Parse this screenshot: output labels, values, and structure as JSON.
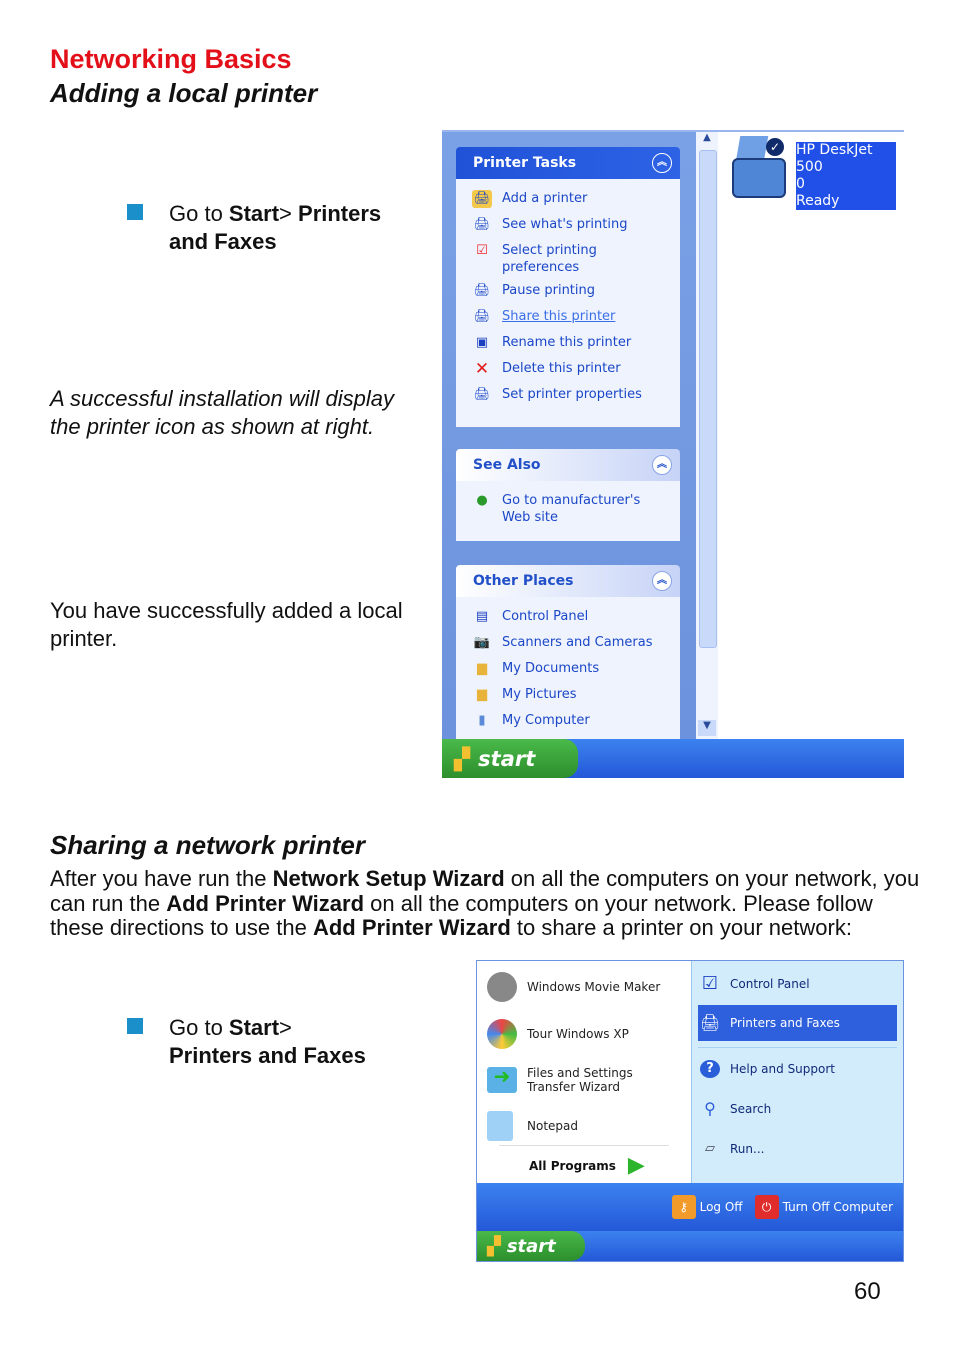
{
  "header": {
    "section": "Networking Basics",
    "subtitle": "Adding a local printer"
  },
  "step1": {
    "prefix": "Go to ",
    "start": "Start",
    "sep": "> ",
    "target": "Printers and Faxes"
  },
  "note1": "A successful installation will display the printer icon as shown at right.",
  "note2": "You have successfully added a local printer.",
  "screenshot1": {
    "printer_tasks": {
      "title": "Printer Tasks",
      "items": [
        "Add a printer",
        "See what's printing",
        "Select printing preferences",
        "Pause printing",
        "Share this printer",
        "Rename this printer",
        "Delete this printer",
        "Set printer properties"
      ]
    },
    "see_also": {
      "title": "See Also",
      "items": [
        "Go to manufacturer's Web site"
      ]
    },
    "other_places": {
      "title": "Other Places",
      "items": [
        "Control Panel",
        "Scanners and Cameras",
        "My Documents",
        "My Pictures",
        "My Computer"
      ]
    },
    "printer": {
      "name_line1": "HP DeskJet 500",
      "name_line2": "0",
      "status": "Ready"
    },
    "start": "start"
  },
  "section2": {
    "title": "Sharing a network printer",
    "p": [
      "After you have run the ",
      "Network Setup Wizard",
      " on all the computers on your network, you can run the ",
      "Add Printer Wizard",
      " on all the computers on your network.  Please follow these directions to use the ",
      "Add Printer Wizard",
      " to share a printer on your network:"
    ]
  },
  "step2": {
    "prefix": "Go to ",
    "start": "Start",
    "sep": ">",
    "target": "Printers and Faxes"
  },
  "screenshot2": {
    "left": [
      "Windows Movie Maker",
      "Tour Windows XP",
      "Files and Settings Transfer Wizard",
      "Notepad"
    ],
    "all_programs": "All Programs",
    "right": [
      "Control Panel",
      "Printers and Faxes",
      "Help and Support",
      "Search",
      "Run..."
    ],
    "log_off": "Log Off",
    "turn_off": "Turn Off Computer",
    "start": "start"
  },
  "page_number": "60"
}
